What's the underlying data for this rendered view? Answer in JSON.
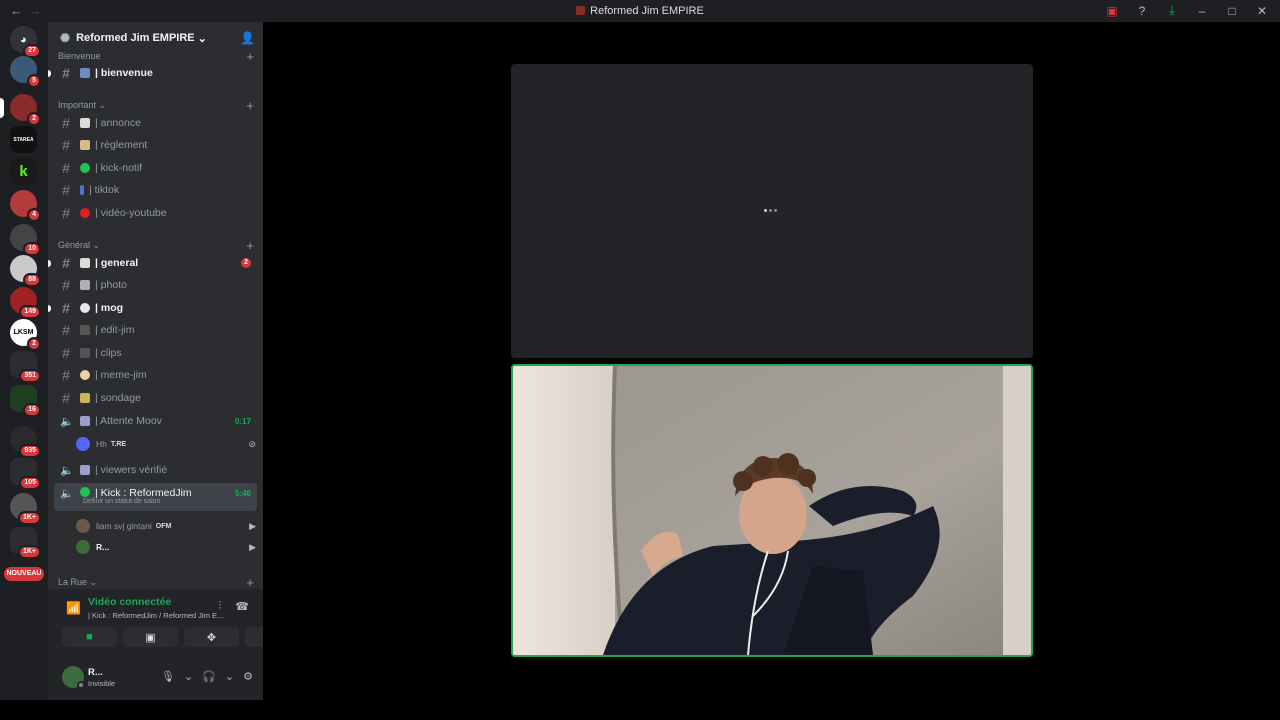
{
  "window": {
    "title": "Reformed Jim EMPIRE"
  },
  "guilds": [
    {
      "name": "direct-messages",
      "badge": "27",
      "color": "#5865f2"
    },
    {
      "name": "guild-2",
      "badge": "5",
      "color": "#3a5a7a"
    },
    {
      "name": "guild-3",
      "badge": "2",
      "color": "#8a2b2b"
    },
    {
      "name": "guild-starea",
      "badge": "",
      "color": "#111111",
      "text": "STAREA"
    },
    {
      "name": "guild-kick",
      "badge": "",
      "color": "#1a1a1a",
      "text": "k"
    },
    {
      "name": "guild-6",
      "badge": "4",
      "color": "#b33b3b"
    },
    {
      "name": "guild-7",
      "badge": "10",
      "color": "#444"
    },
    {
      "name": "guild-8",
      "badge": "88",
      "color": "#c9c9c9"
    },
    {
      "name": "guild-9",
      "badge": "149",
      "color": "#a02222"
    },
    {
      "name": "guild-lksm",
      "badge": "2",
      "color": "#ffffff",
      "text": "LKSM"
    },
    {
      "name": "guild-folder-1",
      "badge": "351",
      "color": "#2b2d31"
    },
    {
      "name": "guild-12",
      "badge": "16",
      "color": "#1f3d1f"
    },
    {
      "name": "guild-13",
      "badge": "935",
      "color": "#2a2a2a"
    },
    {
      "name": "guild-folder-2",
      "badge": "105",
      "color": "#2b2d31"
    },
    {
      "name": "guild-15",
      "badge": "1K+",
      "color": "#555"
    },
    {
      "name": "guild-folder-3",
      "badge": "1K+",
      "color": "#2b2d31"
    }
  ],
  "nouveau_label": "NOUVEAU",
  "server": {
    "name": "Reformed Jim EMPIRE",
    "chevron": "⌄"
  },
  "categories": {
    "bienvenue": "Bienvenue",
    "important": "Important ⌄",
    "general": "Général ⌄",
    "larue": "La Rue ⌄"
  },
  "channels": {
    "bienvenue": "| bienvenue",
    "annonce": "| annonce",
    "reglement": "| règlement",
    "kick_notif": "| kick-notif",
    "tiktok": "| tiktok",
    "video_youtube": "| vidéo-youtube",
    "general": "| general",
    "general_badge": "2",
    "photo": "| photo",
    "mog": "| mog",
    "edit_jim": "| edit-jim",
    "clips": "| clips",
    "meme_jim": "| meme-jim",
    "sondage": "| sondage",
    "attente_moov": "| Attente Moov",
    "attente_moov_time": "0:17",
    "viewers_verifie": "| viewers vérifié",
    "kick_reformedjim": "| Kick : ReformedJim",
    "kick_time": "5:46",
    "kick_status": "Définir un statut de salon"
  },
  "voice_users": {
    "hh": "Hh",
    "hh_tag": "T.RE",
    "liam": "liam svj gintani",
    "liam_tag": "OFM",
    "r": "R..."
  },
  "voice_panel": {
    "connected": "Vidéo connectée",
    "location": "| Kick : ReformedJim / Reformed Jim E..."
  },
  "user": {
    "name": "R...",
    "status": "Invisible"
  }
}
